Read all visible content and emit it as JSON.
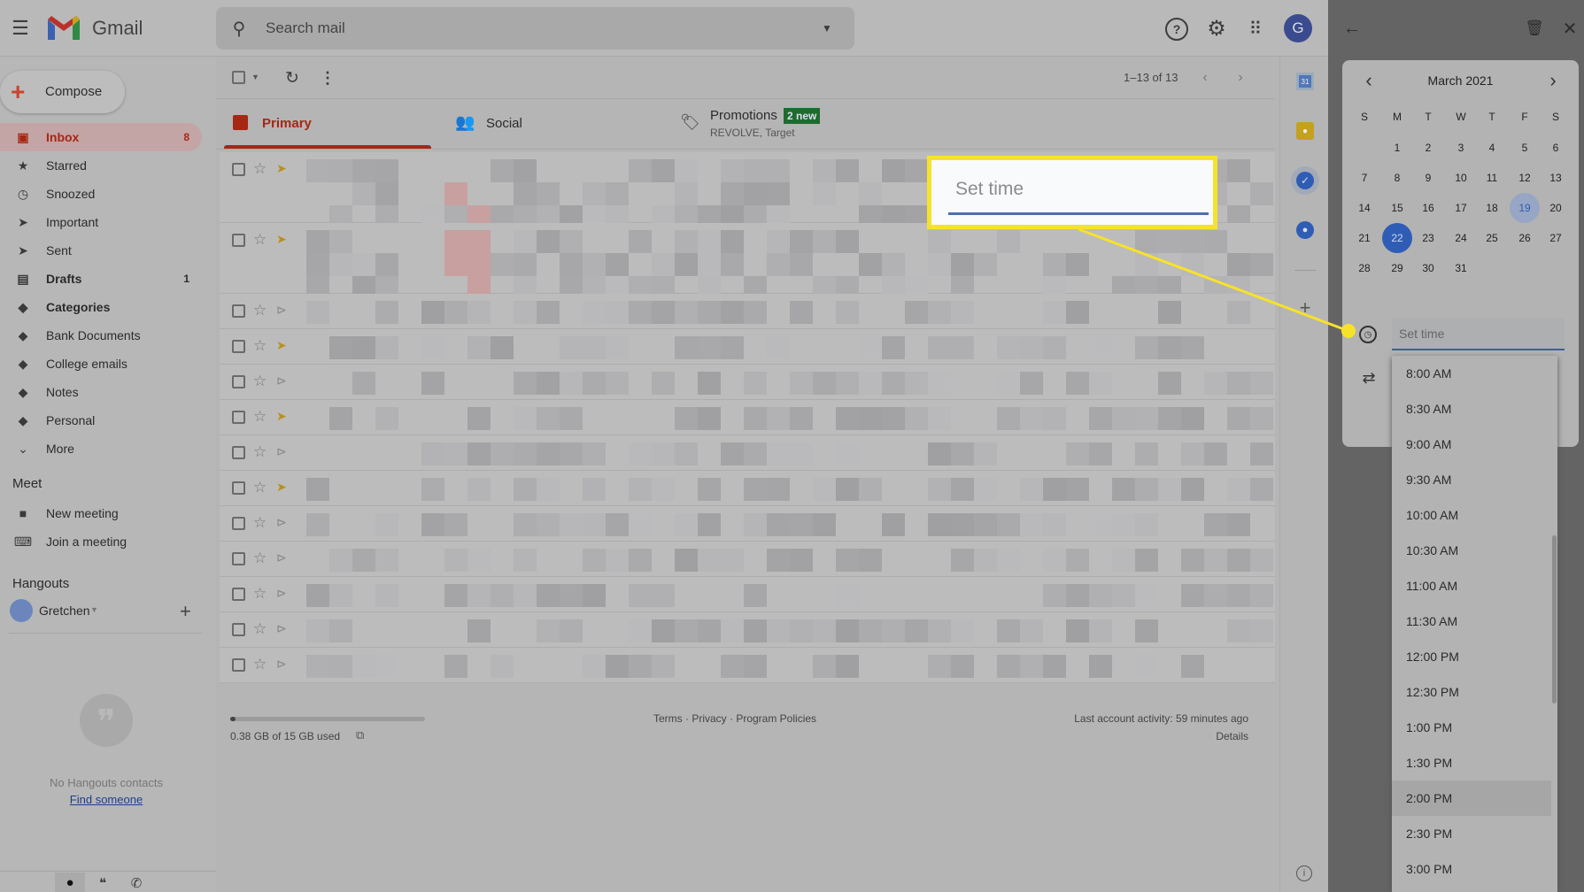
{
  "header": {
    "app_name": "Gmail",
    "search_placeholder": "Search mail",
    "avatar_letter": "G"
  },
  "sidebar": {
    "compose": "Compose",
    "items": [
      {
        "label": "Inbox",
        "count": "8",
        "icon": "inbox-icon",
        "active": true,
        "bold": true
      },
      {
        "label": "Starred",
        "icon": "star-icon"
      },
      {
        "label": "Snoozed",
        "icon": "clock-icon"
      },
      {
        "label": "Important",
        "icon": "important-icon"
      },
      {
        "label": "Sent",
        "icon": "send-icon"
      },
      {
        "label": "Drafts",
        "count": "1",
        "icon": "draft-icon",
        "bold": true
      },
      {
        "label": "Categories",
        "icon": "label-icon",
        "bold": true
      },
      {
        "label": "Bank Documents",
        "icon": "label-icon"
      },
      {
        "label": "College emails",
        "icon": "label-icon"
      },
      {
        "label": "Notes",
        "icon": "label-icon"
      },
      {
        "label": "Personal",
        "icon": "label-icon"
      },
      {
        "label": "More",
        "icon": "chevron-down-icon"
      }
    ],
    "meet": {
      "title": "Meet",
      "new_meeting": "New meeting",
      "join": "Join a meeting"
    },
    "hangouts": {
      "title": "Hangouts",
      "user": "Gretchen",
      "empty": "No Hangouts contacts",
      "find": "Find someone"
    }
  },
  "toolbar": {
    "pagination": "1–13 of 13"
  },
  "tabs": [
    {
      "label": "Primary",
      "active": true
    },
    {
      "label": "Social"
    },
    {
      "label": "Promotions",
      "badge": "2 new",
      "sub": "REVOLVE, Target"
    }
  ],
  "rows": [
    {
      "important": true
    },
    {
      "important": true
    },
    {
      "important": false
    },
    {
      "important": true
    },
    {
      "important": false
    },
    {
      "important": true
    },
    {
      "important": false
    },
    {
      "important": true
    },
    {
      "important": false
    },
    {
      "important": false
    },
    {
      "important": false
    },
    {
      "important": false
    },
    {
      "important": false
    }
  ],
  "footer": {
    "storage": "0.38 GB of 15 GB used",
    "storage_fraction": 0.025,
    "links": "Terms · Privacy · Program Policies",
    "activity": "Last account activity: 59 minutes ago",
    "details": "Details"
  },
  "calendar": {
    "month": "March 2021",
    "weekdays": [
      "S",
      "M",
      "T",
      "W",
      "T",
      "F",
      "S"
    ],
    "first_weekday": 1,
    "days": 31,
    "today": 19,
    "selected": 22
  },
  "time": {
    "placeholder": "Set time",
    "options": [
      "8:00 AM",
      "8:30 AM",
      "9:00 AM",
      "9:30 AM",
      "10:00 AM",
      "10:30 AM",
      "11:00 AM",
      "11:30 AM",
      "12:00 PM",
      "12:30 PM",
      "1:00 PM",
      "1:30 PM",
      "2:00 PM",
      "2:30 PM",
      "3:00 PM"
    ],
    "highlighted": "2:00 PM"
  },
  "callout": {
    "text": "Set time"
  },
  "colors": {
    "accent_red": "#a52714",
    "selected_blue": "#2f5db5",
    "callout_yellow": "#f7e22a",
    "badge_green": "#1e6b2e"
  }
}
